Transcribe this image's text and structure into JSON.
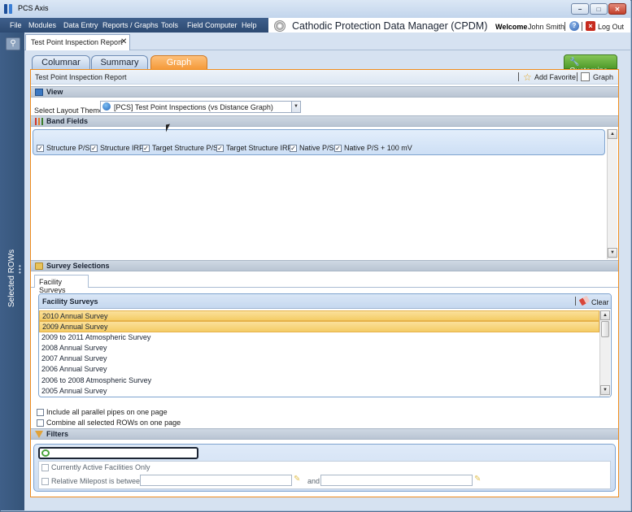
{
  "window": {
    "title": "PCS Axis",
    "controls": [
      "−",
      "□",
      "✕"
    ]
  },
  "menu": [
    "File",
    "Modules",
    "Data Entry",
    "Reports / Graphs",
    "Tools",
    "Field Computer",
    "Help"
  ],
  "header": {
    "app_title": "Cathodic Protection Data Manager (CPDM)",
    "welcome": "Welcome",
    "user": "John Smith",
    "logout": "Log Out"
  },
  "sidebar": {
    "label": "Selected ROWs",
    "search_icon": "search-icon"
  },
  "doc_tab": {
    "label": "Test Point Inspection Report",
    "close": "✕"
  },
  "view_tabs": [
    {
      "label": "Columnar",
      "active": false
    },
    {
      "label": "Summary",
      "active": false
    },
    {
      "label": "Graph",
      "active": true
    }
  ],
  "customize": "Customize",
  "report": {
    "title": "Test Point Inspection Report",
    "add_favorite": "Add Favorite",
    "graph": "Graph"
  },
  "view_section": {
    "heading": "View",
    "layout_theme_label": "Select Layout Theme",
    "layout_theme_value": "[PCS] Test Point Inspections (vs Distance Graph)"
  },
  "band_fields": {
    "heading": "Band Fields",
    "items": [
      {
        "label": "Structure P/S",
        "checked": true
      },
      {
        "label": "Structure IRF",
        "checked": true
      },
      {
        "label": "Target Structure P/S",
        "checked": true
      },
      {
        "label": "Target Structure IRF",
        "checked": true
      },
      {
        "label": "Native P/S",
        "checked": true
      },
      {
        "label": "Native P/S + 100 mV",
        "checked": true
      }
    ]
  },
  "survey_selections": {
    "heading": "Survey Selections",
    "tab": "Facility Surveys",
    "panel_title": "Facility Surveys",
    "clear": "Clear",
    "surveys": [
      {
        "name": "2010 Annual Survey",
        "selected": true
      },
      {
        "name": "2009 Annual Survey",
        "selected": true
      },
      {
        "name": "2009 to 2011 Atmospheric Survey",
        "selected": false
      },
      {
        "name": "2008 Annual Survey",
        "selected": false
      },
      {
        "name": "2007 Annual Survey",
        "selected": false
      },
      {
        "name": "2006 Annual Survey",
        "selected": false
      },
      {
        "name": "2006 to 2008 Atmospheric Survey",
        "selected": false
      },
      {
        "name": "2005 Annual Survey",
        "selected": false
      }
    ],
    "options": [
      {
        "label": "Include all parallel pipes on one page",
        "checked": false
      },
      {
        "label": "Combine all selected ROWs on one page",
        "checked": false
      }
    ]
  },
  "filters": {
    "heading": "Filters",
    "active_only": "Currently Active Facilities Only",
    "milepost_label": "Relative Milepost is between",
    "and": "and"
  },
  "colors": {
    "accent": "#f59a3a",
    "menubar": "#2d4a71",
    "customize": "#4f9a2a",
    "selection": "#f4cc66"
  }
}
